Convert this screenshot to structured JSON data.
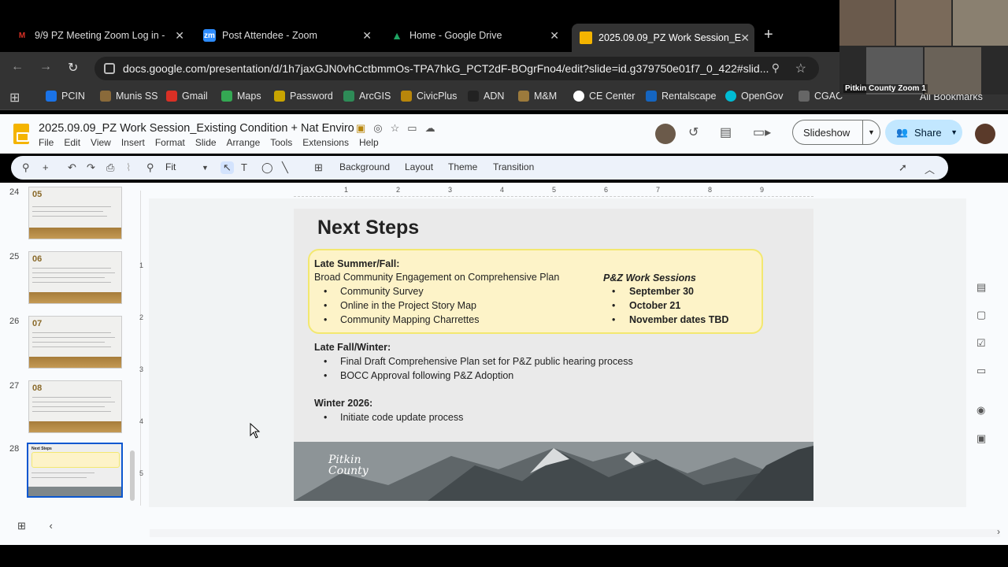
{
  "browser": {
    "tabs": [
      {
        "title": "9/9 PZ Meeting Zoom Log in -",
        "icon_color": "#d93025"
      },
      {
        "title": "Post Attendee - Zoom",
        "icon_color": "#2d8cff"
      },
      {
        "title": "Home - Google Drive",
        "icon_color": "#1fa463"
      },
      {
        "title": "2025.09.09_PZ Work Session_E",
        "icon_color": "#f4b400"
      }
    ],
    "url": "docs.google.com/presentation/d/1h7jaxGJN0vhCctbmmOs-TPA7hkG_PCT2dF-BOgrFno4/edit?slide=id.g379750e01f7_0_422#slid...",
    "bookmarks": [
      "PCIN",
      "Munis SS",
      "Gmail",
      "Maps",
      "Password",
      "ArcGIS",
      "CivicPlus",
      "ADN",
      "M&M",
      "CE Center",
      "Rentalscape",
      "OpenGov",
      "CGAC"
    ],
    "all_bookmarks": "All Bookmarks"
  },
  "doc": {
    "title": "2025.09.09_PZ Work Session_Existing Condition + Nat Enviro",
    "menu": [
      "File",
      "Edit",
      "View",
      "Insert",
      "Format",
      "Slide",
      "Arrange",
      "Tools",
      "Extensions",
      "Help"
    ],
    "slideshow_label": "Slideshow",
    "share_label": "Share"
  },
  "toolbar": {
    "zoom": "Fit",
    "background": "Background",
    "layout": "Layout",
    "theme": "Theme",
    "transition": "Transition"
  },
  "filmstrip": [
    {
      "num": "24",
      "badge": "05"
    },
    {
      "num": "25",
      "badge": "06"
    },
    {
      "num": "26",
      "badge": "07"
    },
    {
      "num": "27",
      "badge": "08"
    },
    {
      "num": "28",
      "badge": "Next Steps"
    }
  ],
  "ruler": [
    "1",
    "2",
    "3",
    "4",
    "5",
    "6",
    "7",
    "8",
    "9"
  ],
  "ruler_v": [
    "1",
    "2",
    "3",
    "4",
    "5"
  ],
  "slide": {
    "title": "Next Steps",
    "late_summer_heading": "Late Summer/Fall:",
    "late_summer_sub": "Broad Community Engagement on Comprehensive Plan",
    "late_summer_items": [
      "Community Survey",
      "Online in the Project Story Map",
      "Community Mapping Charrettes"
    ],
    "pz_heading": "P&Z Work Sessions",
    "pz_items": [
      "September 30",
      "October 21",
      "November dates TBD"
    ],
    "late_fall_heading": "Late Fall/Winter:",
    "late_fall_items": [
      "Final Draft Comprehensive Plan set for P&Z public hearing process",
      "BOCC Approval following P&Z Adoption"
    ],
    "winter_heading": "Winter 2026:",
    "winter_items": [
      "Initiate code update process"
    ],
    "logo_line1": "Pitkin",
    "logo_line2": "County"
  },
  "zoom_overlay": {
    "label": "Pitkin County Zoom 1"
  }
}
